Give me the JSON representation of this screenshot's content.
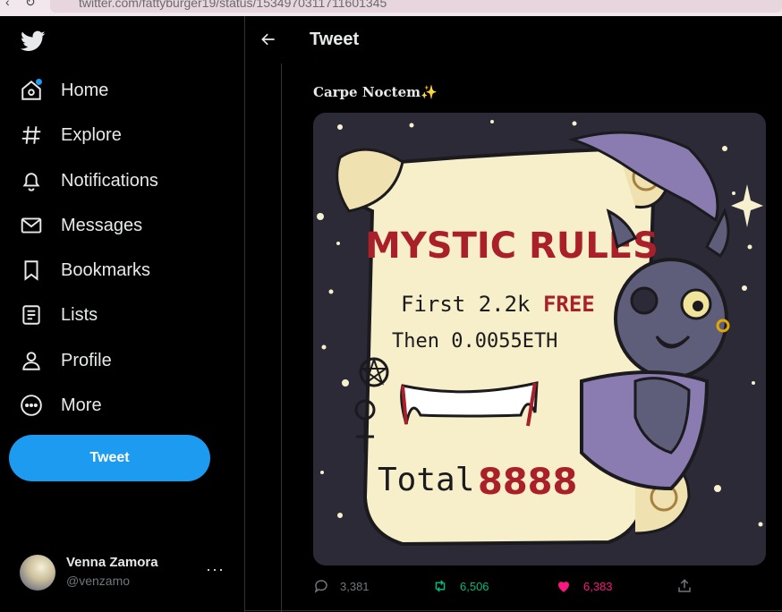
{
  "browser": {
    "url": "twitter.com/fattyburger19/status/1534970311711601345"
  },
  "sidebar": {
    "logo": "twitter-bird-icon",
    "items": [
      {
        "label": "Home",
        "icon": "home-icon",
        "badge": true
      },
      {
        "label": "Explore",
        "icon": "hashtag-icon"
      },
      {
        "label": "Notifications",
        "icon": "bell-icon"
      },
      {
        "label": "Messages",
        "icon": "envelope-icon"
      },
      {
        "label": "Bookmarks",
        "icon": "bookmark-icon"
      },
      {
        "label": "Lists",
        "icon": "list-icon"
      },
      {
        "label": "Profile",
        "icon": "person-icon"
      },
      {
        "label": "More",
        "icon": "more-circle-icon"
      }
    ],
    "tweet_button": "Tweet",
    "account": {
      "name": "Venna Zamora",
      "handle": "@venzamo",
      "more": "···"
    }
  },
  "header": {
    "title": "Tweet"
  },
  "tweet": {
    "text": "Carpe Noctem",
    "emoji": "✨",
    "image": {
      "heading": "MYSTIC RULES",
      "line1_prefix": "First 2.2k ",
      "line1_highlight": "FREE",
      "line2": "Then 0.0055ETH",
      "total_label": "Total",
      "total_value": "8888"
    },
    "actions": {
      "replies": "3,381",
      "retweets": "6,506",
      "likes": "6,383"
    }
  },
  "colors": {
    "accent": "#1d9bf0",
    "retweet": "#00ba7c",
    "like": "#f91880",
    "background": "#000000"
  }
}
